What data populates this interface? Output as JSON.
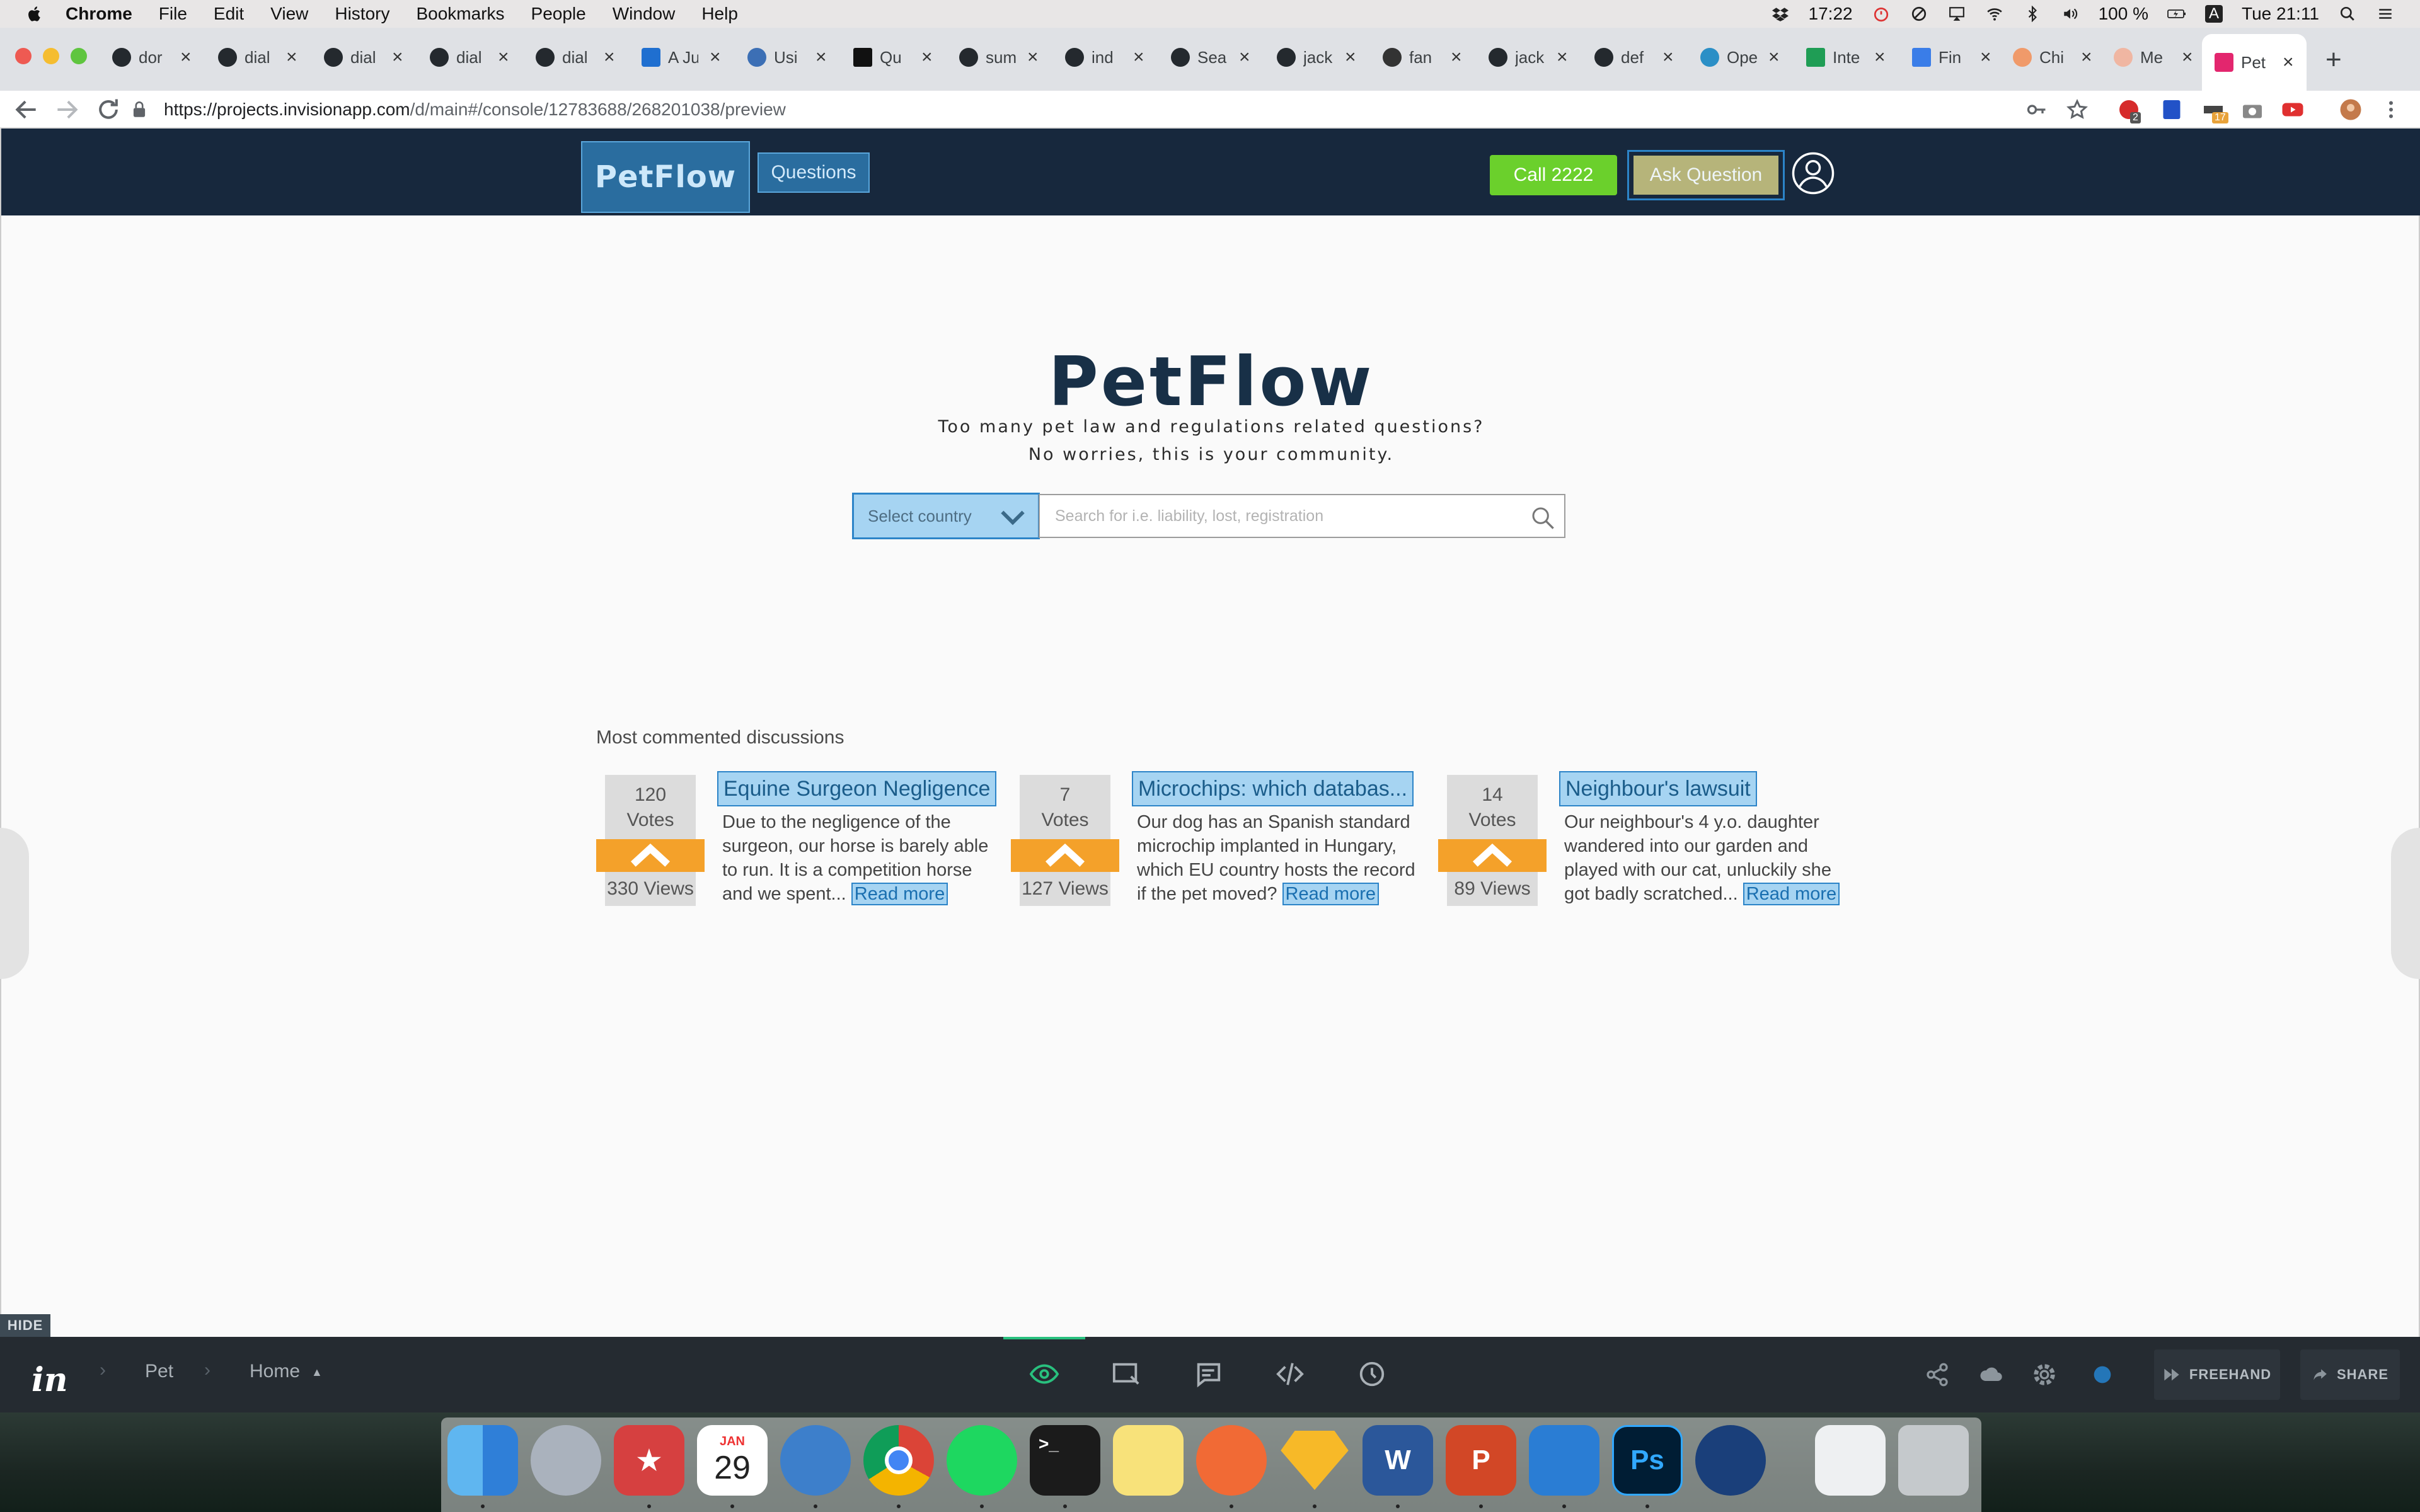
{
  "menubar": {
    "app": "Chrome",
    "items": [
      "File",
      "Edit",
      "View",
      "History",
      "Bookmarks",
      "People",
      "Window",
      "Help"
    ],
    "clock_status": "17:22",
    "battery": "100 %",
    "input_source": "A",
    "datetime": "Tue 21:11"
  },
  "browser": {
    "tabs": [
      {
        "label": "dor",
        "icon": "github-icon"
      },
      {
        "label": "dial",
        "icon": "github-icon"
      },
      {
        "label": "dial",
        "icon": "github-icon"
      },
      {
        "label": "dial",
        "icon": "github-icon"
      },
      {
        "label": "dial",
        "icon": "github-icon"
      },
      {
        "label": "A Ju",
        "icon": "azure-icon"
      },
      {
        "label": "Usi",
        "icon": "link-icon"
      },
      {
        "label": "Qu",
        "icon": "medium-icon"
      },
      {
        "label": "sum",
        "icon": "github-icon"
      },
      {
        "label": "ind",
        "icon": "github-icon"
      },
      {
        "label": "Sea",
        "icon": "github-icon"
      },
      {
        "label": "jack",
        "icon": "github-icon"
      },
      {
        "label": "fan",
        "icon": "stack-icon"
      },
      {
        "label": "jack",
        "icon": "github-icon"
      },
      {
        "label": "def",
        "icon": "github-icon"
      },
      {
        "label": "Ope",
        "icon": "wordpress-icon"
      },
      {
        "label": "Inte",
        "icon": "sheets-icon"
      },
      {
        "label": "Fin",
        "icon": "docs-icon"
      },
      {
        "label": "Chi",
        "icon": "chi-icon"
      },
      {
        "label": "Me",
        "icon": "me-icon"
      }
    ],
    "active_tab": {
      "label": "Pet",
      "icon": "invision-icon"
    },
    "url_host": "https://projects.invisionapp.com",
    "url_path": "/d/main#/console/12783688/268201038/preview",
    "profile_badge": "2",
    "extension_badge": "17"
  },
  "app": {
    "logo": "PetFlow",
    "nav_questions": "Questions",
    "call_button": "Call 2222",
    "ask_button": "Ask Question",
    "hero_title": "PetFlow",
    "hero_line1": "Too many pet law and regulations related questions?",
    "hero_line2": "No worries, this is your community.",
    "country_select": "Select country",
    "search_placeholder": "Search for i.e. liability, lost, registration",
    "section_title": "Most commented discussions",
    "votes_label": "Votes",
    "read_more": "Read more",
    "discussions": [
      {
        "votes": "120",
        "views": "330 Views",
        "title": "Equine Surgeon Negligence",
        "excerpt": "Due to the negligence of the surgeon, our horse is barely able to run. It is a competition horse and we spent..."
      },
      {
        "votes": "7",
        "views": "127 Views",
        "title": "Microchips: which databas...",
        "excerpt": "Our dog has an Spanish standard microchip implanted in Hungary, which EU country hosts the record if the pet moved?"
      },
      {
        "votes": "14",
        "views": "89 Views",
        "title": "Neighbour's lawsuit",
        "excerpt": "Our neighbour's 4 y.o. daughter wandered into our garden and played with our cat, unluckily she got badly scratched..."
      }
    ]
  },
  "invision": {
    "hide_label": "HIDE",
    "logo": "in",
    "breadcrumb_project": "Pet",
    "breadcrumb_screen": "Home",
    "freehand_label": "FREEHAND",
    "share_label": "SHARE"
  },
  "dock": {
    "calendar_month": "JAN",
    "calendar_day": "29",
    "items": [
      "finder-icon",
      "launchpad-icon",
      "bookmark-app-icon",
      "calendar-icon",
      "migrate-icon",
      "chrome-icon",
      "spotify-icon",
      "terminal-icon",
      "notes-icon",
      "postman-icon",
      "sketch-icon",
      "word-icon",
      "powerpoint-icon",
      "vscode-icon",
      "photoshop-icon",
      "quicktime-icon",
      "document-icon",
      "trash-icon"
    ]
  }
}
